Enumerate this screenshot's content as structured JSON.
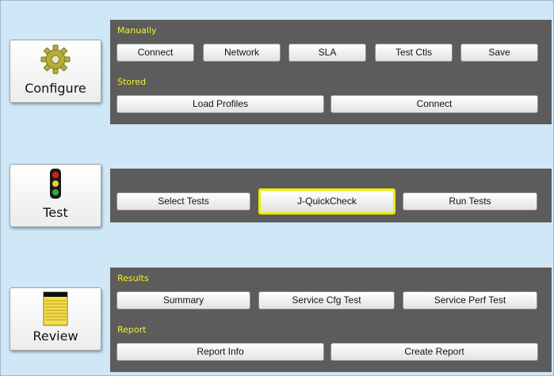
{
  "colors": {
    "background": "#cfe7f7",
    "panel": "#5c5c5c",
    "section_label": "#f4f02a",
    "selection_border": "#f0ea00"
  },
  "side_buttons": {
    "configure": {
      "label": "Configure",
      "icon": "gear-icon"
    },
    "test": {
      "label": "Test",
      "icon": "traffic-light-icon"
    },
    "review": {
      "label": "Review",
      "icon": "notepad-icon"
    }
  },
  "configure_panel": {
    "manually_label": "Manually",
    "manually_buttons": [
      "Connect",
      "Network",
      "SLA",
      "Test Ctls",
      "Save"
    ],
    "stored_label": "Stored",
    "stored_buttons": [
      "Load Profiles",
      "Connect"
    ]
  },
  "test_panel": {
    "buttons": [
      "Select Tests",
      "J-QuickCheck",
      "Run Tests"
    ],
    "selected": "J-QuickCheck"
  },
  "review_panel": {
    "results_label": "Results",
    "results_buttons": [
      "Summary",
      "Service Cfg Test",
      "Service Perf Test"
    ],
    "report_label": "Report",
    "report_buttons": [
      "Report Info",
      "Create Report"
    ]
  }
}
